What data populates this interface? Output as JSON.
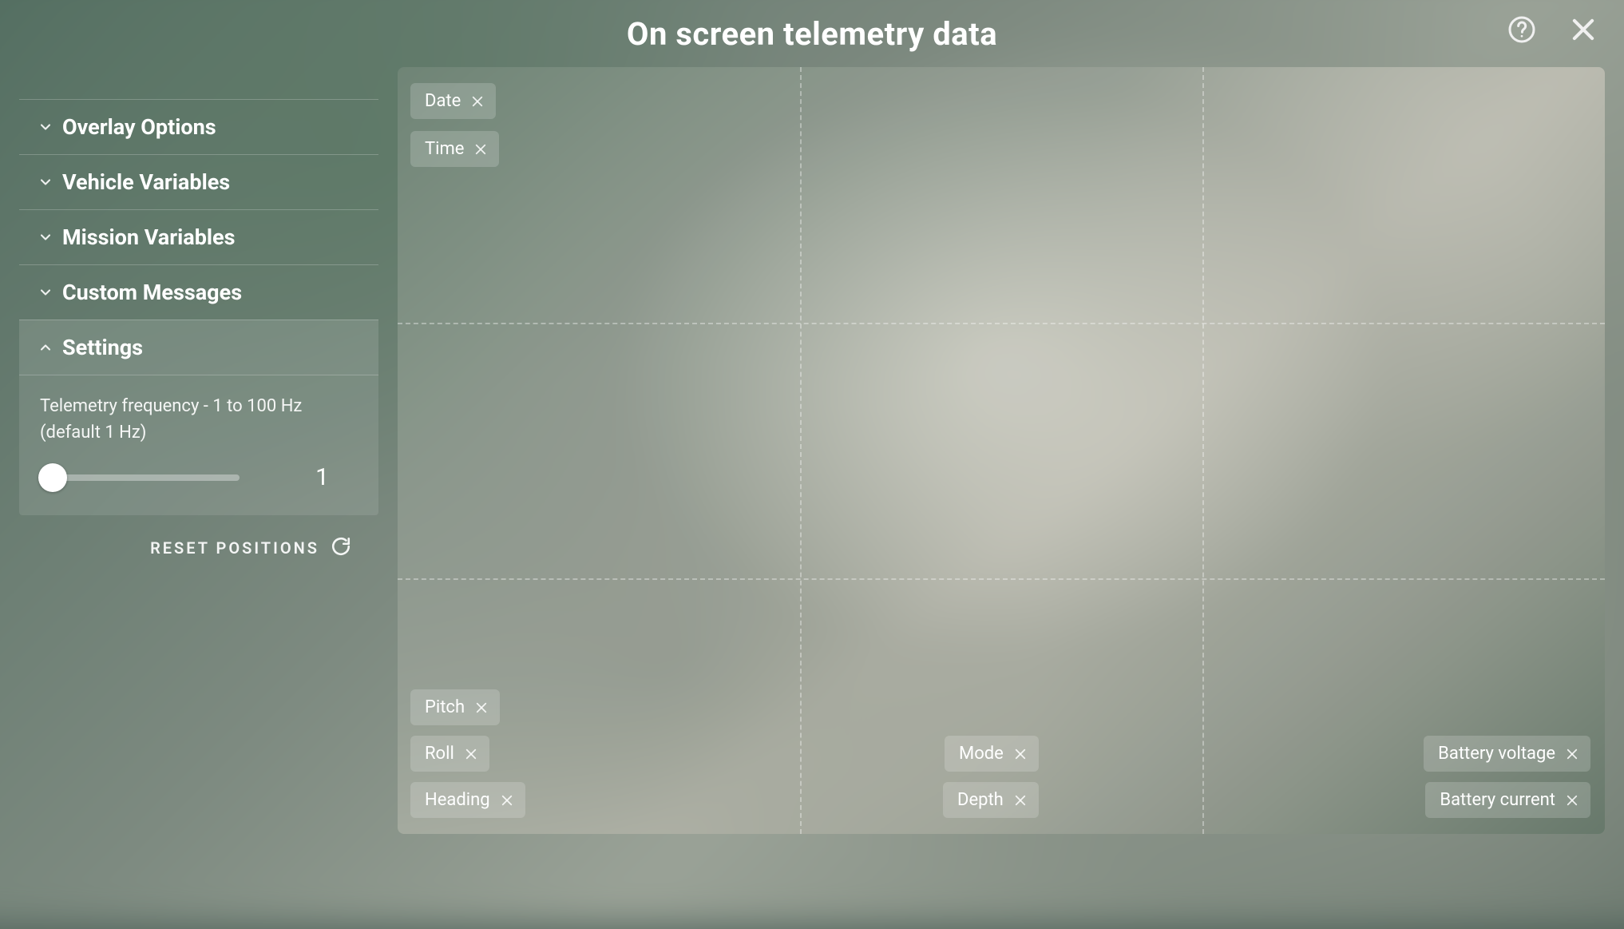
{
  "header": {
    "title": "On screen telemetry data"
  },
  "sidebar": {
    "sections": [
      {
        "label": "Overlay Options",
        "expanded": false
      },
      {
        "label": "Vehicle Variables",
        "expanded": false
      },
      {
        "label": "Mission Variables",
        "expanded": false
      },
      {
        "label": "Custom Messages",
        "expanded": false
      },
      {
        "label": "Settings",
        "expanded": true
      }
    ],
    "settings": {
      "description": "Telemetry frequency - 1 to 100 Hz (default 1 Hz)",
      "slider_value": "1",
      "slider_min": 1,
      "slider_max": 100
    },
    "reset_label": "RESET POSITIONS"
  },
  "canvas": {
    "chips": [
      {
        "id": "date",
        "label": "Date"
      },
      {
        "id": "time",
        "label": "Time"
      },
      {
        "id": "pitch",
        "label": "Pitch"
      },
      {
        "id": "roll",
        "label": "Roll"
      },
      {
        "id": "heading",
        "label": "Heading"
      },
      {
        "id": "mode",
        "label": "Mode"
      },
      {
        "id": "depth",
        "label": "Depth"
      },
      {
        "id": "battery_voltage",
        "label": "Battery voltage"
      },
      {
        "id": "battery_current",
        "label": "Battery current"
      }
    ]
  }
}
